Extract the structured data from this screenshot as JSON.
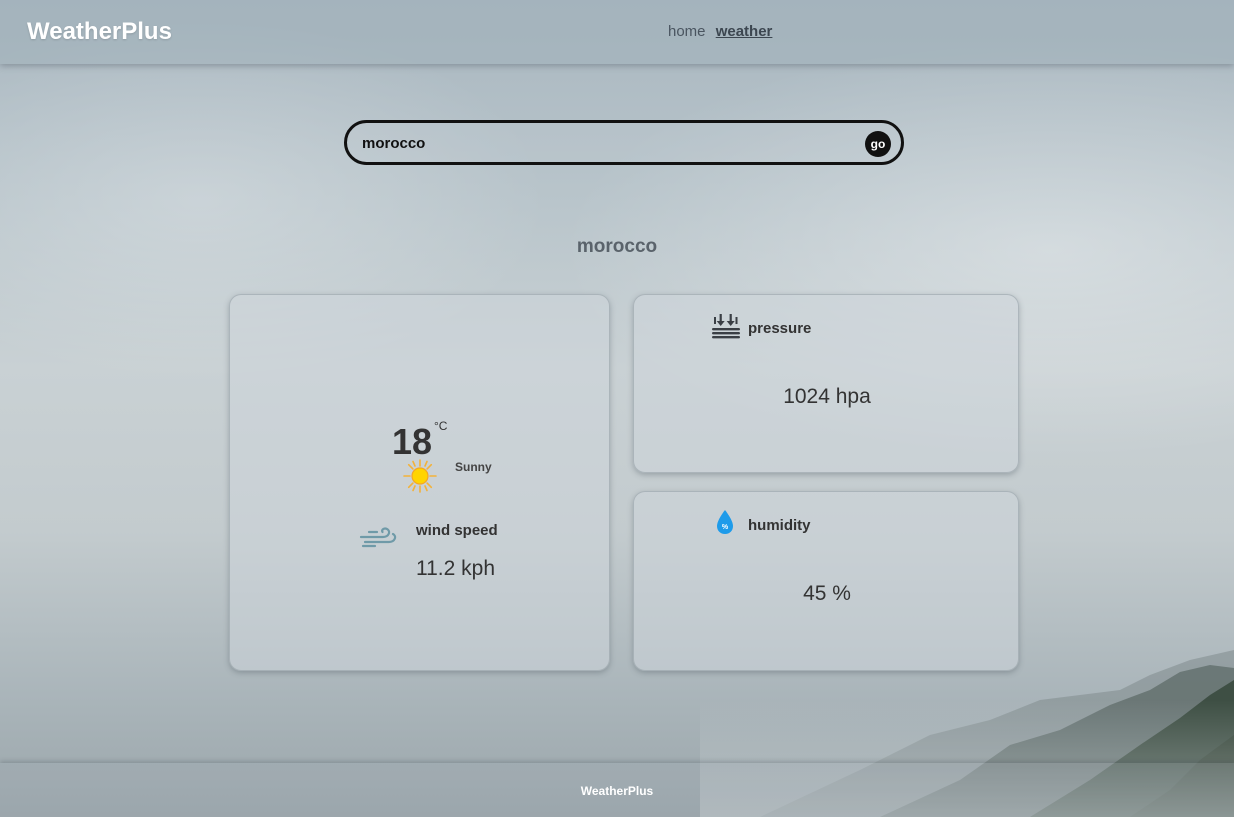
{
  "header": {
    "brand": "WeatherPlus",
    "nav": [
      {
        "label": "home",
        "active": false
      },
      {
        "label": "weather",
        "active": true
      }
    ]
  },
  "search": {
    "value": "morocco",
    "button_label": "go"
  },
  "city": "morocco",
  "current": {
    "temperature": "18",
    "unit": "°C",
    "condition": "Sunny",
    "condition_icon": "sun-icon",
    "wind_label": "wind speed",
    "wind_value": "11.2 kph",
    "wind_icon": "wind-icon"
  },
  "pressure": {
    "label": "pressure",
    "value": "1024 hpa",
    "icon": "pressure-icon"
  },
  "humidity": {
    "label": "humidity",
    "value": "45 %",
    "icon": "humidity-drop-icon"
  },
  "footer": {
    "brand": "WeatherPlus"
  },
  "colors": {
    "sun": "#f5c400",
    "wind": "#6f9aa8",
    "drop": "#1e9bea"
  }
}
